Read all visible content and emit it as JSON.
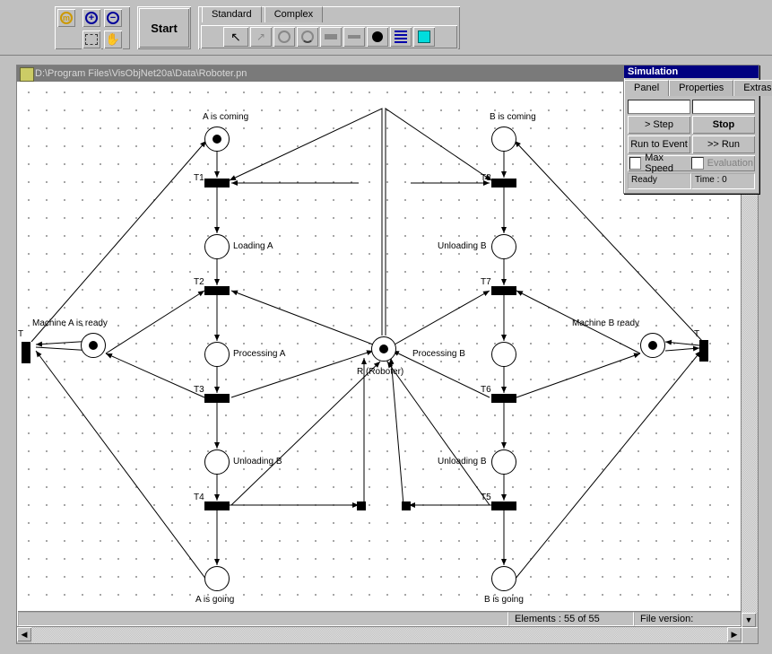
{
  "toolbar": {
    "start_label": "Start",
    "tabs": {
      "standard": "Standard",
      "complex": "Complex"
    }
  },
  "doc": {
    "title": "D:\\Program Files\\VisObjNet20a\\Data\\Roboter.pn",
    "statusbar": {
      "elements": "Elements : 55 of 55",
      "version": "File version:"
    }
  },
  "sim": {
    "title": "Simulation",
    "tabs": {
      "panel": "Panel",
      "properties": "Properties",
      "extras": "Extras"
    },
    "step": "> Step",
    "stop": "Stop",
    "run_to_event": "Run to Event",
    "run": ">> Run",
    "max_speed": "Max Speed",
    "evaluation": "Evaluation",
    "status_ready": "Ready",
    "status_time": "Time : 0"
  },
  "net": {
    "labels": {
      "a_coming": "A is coming",
      "b_coming": "B  is coming",
      "loading_a": "Loading A",
      "unloading_b_top": "Unloading B",
      "machine_a": "Machine A is ready",
      "machine_b": "Machine B ready",
      "processing_a": "Processing A",
      "processing_b": "Processing B",
      "r_roboter": "R (Roboter)",
      "unloading_b_left": "Unloading B",
      "unloading_b_right": "Unloading B",
      "a_going": "A is going",
      "b_going": "B is going",
      "T": "T",
      "T1": "T1",
      "T2": "T2",
      "T3": "T3",
      "T4": "T4",
      "T5": "T5",
      "T6": "T6",
      "T7": "T7",
      "T8": "T8"
    }
  }
}
